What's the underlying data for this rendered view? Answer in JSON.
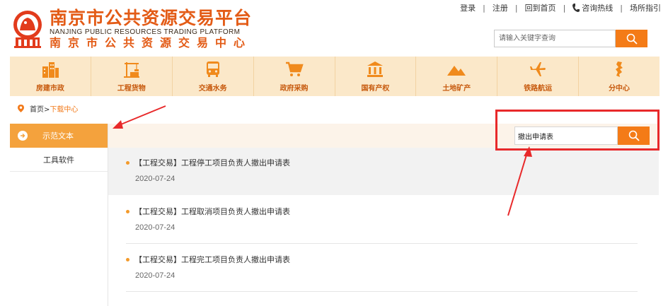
{
  "header": {
    "logo_cn": "南京市公共资源交易平台",
    "logo_en": "NANJING PUBLIC RESOURCES TRADING PLATFORM",
    "logo_sub": "南京市公共资源交易中心",
    "toplinks": {
      "login": "登录",
      "register": "注册",
      "home": "回到首页",
      "hotline": "咨询热线",
      "guide": "场所指引"
    },
    "search": {
      "placeholder": "请输入关键字查询"
    }
  },
  "nav": {
    "items": [
      {
        "label": "房建市政",
        "icon": "building-icon"
      },
      {
        "label": "工程货物",
        "icon": "crane-icon"
      },
      {
        "label": "交通水务",
        "icon": "bus-icon"
      },
      {
        "label": "政府采购",
        "icon": "cart-icon"
      },
      {
        "label": "国有产权",
        "icon": "bank-icon"
      },
      {
        "label": "土地矿产",
        "icon": "mountain-icon"
      },
      {
        "label": "铁路航运",
        "icon": "plane-icon"
      },
      {
        "label": "分中心",
        "icon": "map-icon"
      }
    ]
  },
  "breadcrumb": {
    "home": "首页>",
    "current": "下载中心"
  },
  "sidebar": {
    "active": "示范文本",
    "items": [
      "工具软件"
    ]
  },
  "content": {
    "search_value": "撤出申请表",
    "items": [
      {
        "title": "【工程交易】工程停工项目负责人撤出申请表",
        "date": "2020-07-24"
      },
      {
        "title": "【工程交易】工程取消项目负责人撤出申请表",
        "date": "2020-07-24"
      },
      {
        "title": "【工程交易】工程完工项目负责人撤出申请表",
        "date": "2020-07-24"
      }
    ]
  },
  "colors": {
    "brand_orange": "#f47b17",
    "nav_bg": "#fbe8c9",
    "sidebar_active": "#f4a23d",
    "annotation_red": "#e8292a"
  }
}
